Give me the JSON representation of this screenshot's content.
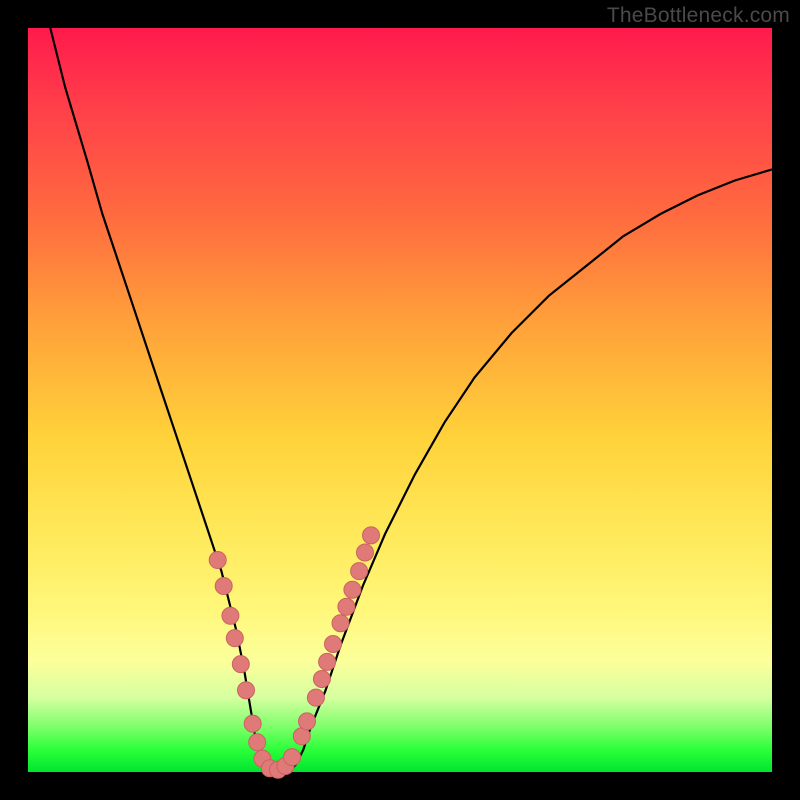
{
  "watermark": "TheBottleneck.com",
  "colors": {
    "curve_stroke": "#000000",
    "marker_fill": "#e07a78",
    "marker_stroke": "#c96360"
  },
  "chart_data": {
    "type": "line",
    "title": "",
    "xlabel": "",
    "ylabel": "",
    "xlim": [
      0,
      100
    ],
    "ylim": [
      0,
      100
    ],
    "x": [
      3,
      5,
      8,
      10,
      12,
      14,
      16,
      18,
      20,
      22,
      24,
      25,
      26,
      27,
      28,
      29,
      29.5,
      30,
      30.5,
      31,
      32,
      33,
      34,
      35,
      36,
      37,
      38,
      40,
      42,
      45,
      48,
      52,
      56,
      60,
      65,
      70,
      75,
      80,
      85,
      90,
      95,
      100
    ],
    "values": [
      100,
      92,
      82,
      75,
      69,
      63,
      57,
      51,
      45,
      39,
      33,
      30,
      27,
      23,
      19,
      14,
      11,
      8,
      5,
      3,
      1,
      0,
      0,
      0,
      1,
      3,
      6,
      11,
      17,
      25,
      32,
      40,
      47,
      53,
      59,
      64,
      68,
      72,
      75,
      77.5,
      79.5,
      81
    ],
    "series": [
      {
        "name": "curve",
        "x": [
          3,
          5,
          8,
          10,
          12,
          14,
          16,
          18,
          20,
          22,
          24,
          25,
          26,
          27,
          28,
          29,
          29.5,
          30,
          30.5,
          31,
          32,
          33,
          34,
          35,
          36,
          37,
          38,
          40,
          42,
          45,
          48,
          52,
          56,
          60,
          65,
          70,
          75,
          80,
          85,
          90,
          95,
          100
        ],
        "values": [
          100,
          92,
          82,
          75,
          69,
          63,
          57,
          51,
          45,
          39,
          33,
          30,
          27,
          23,
          19,
          14,
          11,
          8,
          5,
          3,
          1,
          0,
          0,
          0,
          1,
          3,
          6,
          11,
          17,
          25,
          32,
          40,
          47,
          53,
          59,
          64,
          68,
          72,
          75,
          77.5,
          79.5,
          81
        ]
      }
    ],
    "markers": [
      {
        "x": 25.5,
        "y": 28.5
      },
      {
        "x": 26.3,
        "y": 25.0
      },
      {
        "x": 27.2,
        "y": 21.0
      },
      {
        "x": 27.8,
        "y": 18.0
      },
      {
        "x": 28.6,
        "y": 14.5
      },
      {
        "x": 29.3,
        "y": 11.0
      },
      {
        "x": 30.2,
        "y": 6.5
      },
      {
        "x": 30.8,
        "y": 4.0
      },
      {
        "x": 31.5,
        "y": 1.8
      },
      {
        "x": 32.5,
        "y": 0.5
      },
      {
        "x": 33.6,
        "y": 0.3
      },
      {
        "x": 34.6,
        "y": 0.8
      },
      {
        "x": 35.5,
        "y": 2.0
      },
      {
        "x": 36.8,
        "y": 4.8
      },
      {
        "x": 37.5,
        "y": 6.8
      },
      {
        "x": 38.7,
        "y": 10.0
      },
      {
        "x": 39.5,
        "y": 12.5
      },
      {
        "x": 40.2,
        "y": 14.8
      },
      {
        "x": 41.0,
        "y": 17.2
      },
      {
        "x": 42.0,
        "y": 20.0
      },
      {
        "x": 42.8,
        "y": 22.2
      },
      {
        "x": 43.6,
        "y": 24.5
      },
      {
        "x": 44.5,
        "y": 27.0
      },
      {
        "x": 45.3,
        "y": 29.5
      },
      {
        "x": 46.1,
        "y": 31.8
      }
    ]
  }
}
